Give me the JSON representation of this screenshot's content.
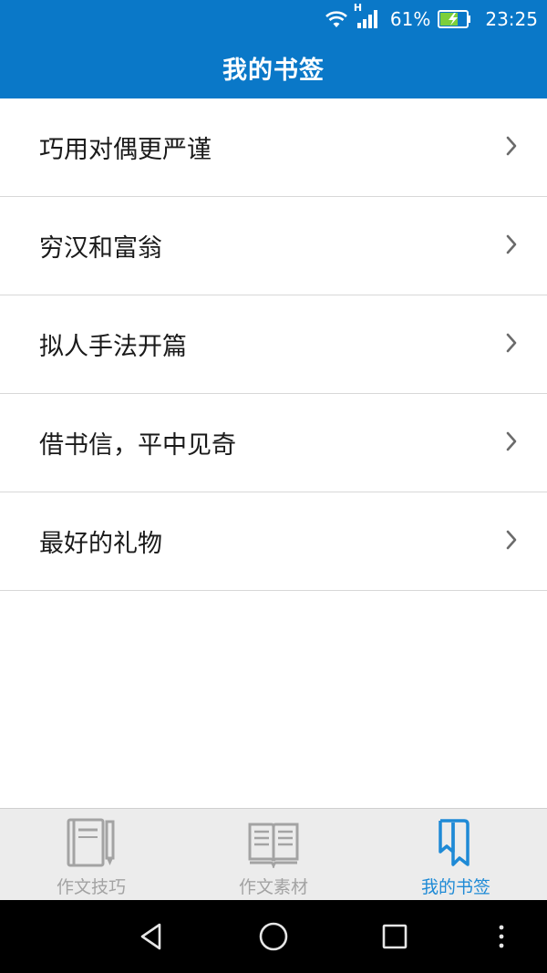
{
  "status_bar": {
    "network_type": "H",
    "battery_percent": "61%",
    "time": "23:25",
    "icons": [
      "wifi-icon",
      "signal-icon",
      "battery-charging-icon"
    ]
  },
  "header": {
    "title": "我的书签"
  },
  "bookmarks": [
    {
      "label": "巧用对偶更严谨"
    },
    {
      "label": "穷汉和富翁"
    },
    {
      "label": "拟人手法开篇"
    },
    {
      "label": "借书信，平中见奇"
    },
    {
      "label": "最好的礼物"
    }
  ],
  "tabs": [
    {
      "label": "作文技巧",
      "icon": "notebook-pen-icon",
      "active": false
    },
    {
      "label": "作文素材",
      "icon": "open-book-icon",
      "active": false
    },
    {
      "label": "我的书签",
      "icon": "bookmark-icon",
      "active": true
    }
  ],
  "colors": {
    "header_blue": "#0a78c8",
    "active_tab": "#1e8ad6",
    "inactive_tab": "#a3a3a3"
  },
  "system_nav": {
    "icons": [
      "back-icon",
      "home-icon",
      "recents-icon",
      "more-icon"
    ]
  }
}
